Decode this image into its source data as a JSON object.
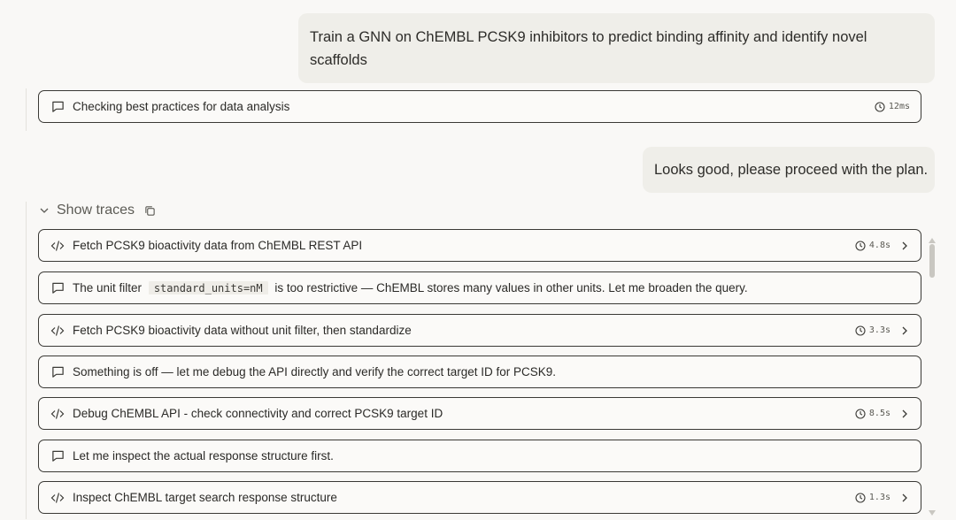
{
  "messages": {
    "first_user": "Train a GNN on ChEMBL PCSK9 inhibitors to predict binding affinity and identify novel scaffolds",
    "second_user": "Looks good, please proceed with the plan."
  },
  "first_trace": {
    "label": "Checking best practices for data analysis",
    "time": "12ms",
    "icon": "message-icon"
  },
  "show_traces_label": "Show traces",
  "traces": [
    {
      "type": "code",
      "icon": "code-icon",
      "label": "Fetch PCSK9 bioactivity data from ChEMBL REST API",
      "time": "4.8s"
    },
    {
      "type": "message",
      "icon": "message-icon",
      "label_before": "The unit filter",
      "code": "standard_units=nM",
      "label_after": "is too restrictive — ChEMBL stores many values in other units. Let me broaden the query."
    },
    {
      "type": "code",
      "icon": "code-icon",
      "label": "Fetch PCSK9 bioactivity data without unit filter, then standardize",
      "time": "3.3s"
    },
    {
      "type": "message",
      "icon": "message-icon",
      "label": "Something is off — let me debug the API directly and verify the correct target ID for PCSK9."
    },
    {
      "type": "code",
      "icon": "code-icon",
      "label": "Debug ChEMBL API - check connectivity and correct PCSK9 target ID",
      "time": "8.5s"
    },
    {
      "type": "message",
      "icon": "message-icon",
      "label": "Let me inspect the actual response structure first."
    },
    {
      "type": "code",
      "icon": "code-icon",
      "label": "Inspect ChEMBL target search response structure",
      "time": "1.3s"
    }
  ],
  "colors": {
    "background": "#f9f8f6",
    "bubble": "#efeee9",
    "border": "#3a3935"
  }
}
